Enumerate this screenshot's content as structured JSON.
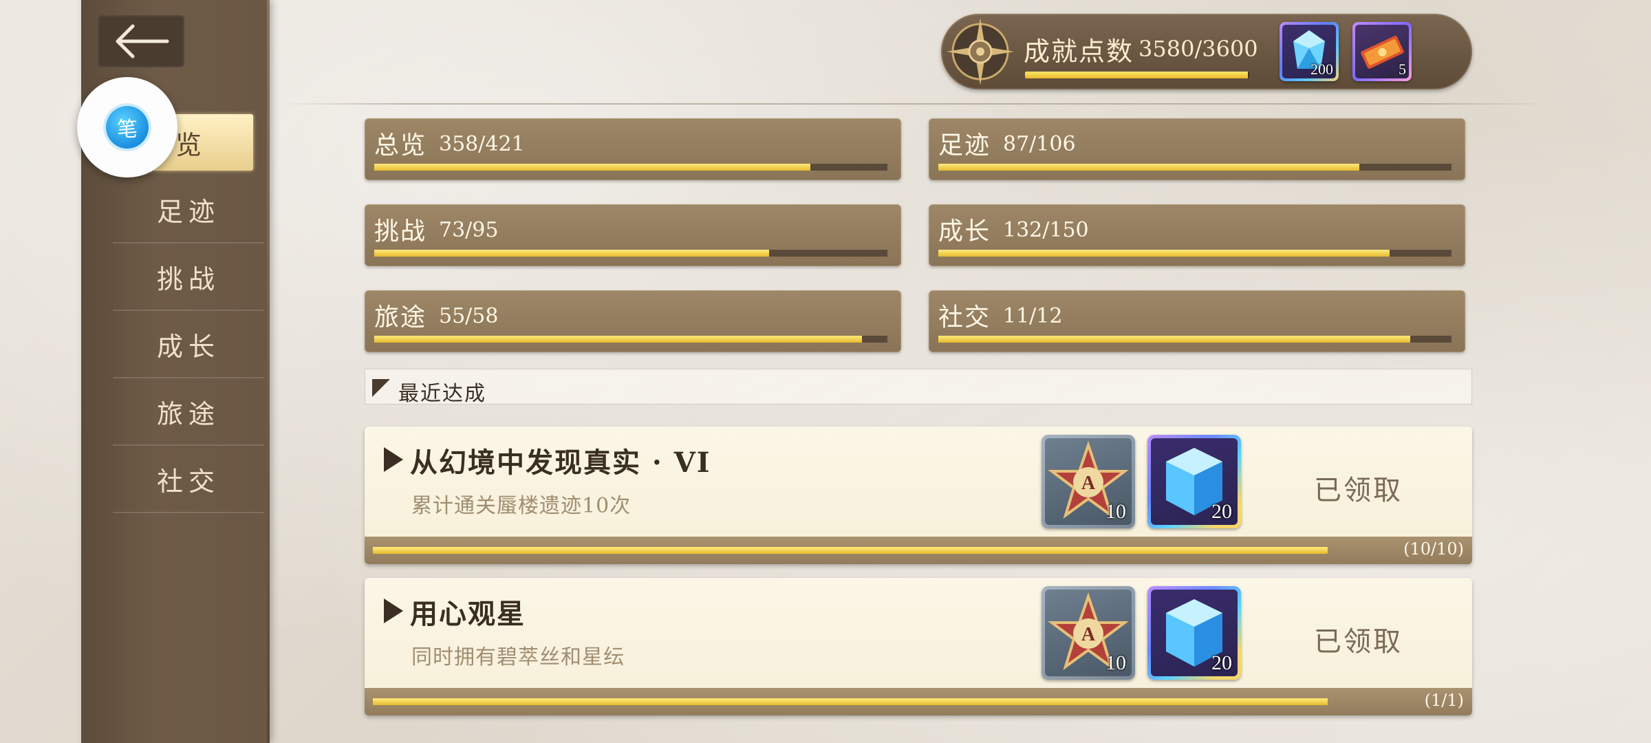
{
  "nav": {
    "items": [
      {
        "label": "总览"
      },
      {
        "label": "足迹"
      },
      {
        "label": "挑战"
      },
      {
        "label": "成长"
      },
      {
        "label": "旅途"
      },
      {
        "label": "社交"
      }
    ],
    "active_visible_text": "览",
    "float_button_glyph": "笔"
  },
  "header": {
    "points_label": "成就点数",
    "points_value": "3580/3600",
    "points_progress": 0.994,
    "items": [
      {
        "name": "crystal-icon",
        "count": "200"
      },
      {
        "name": "ticket-icon",
        "count": "5"
      }
    ]
  },
  "categories": [
    {
      "name": "总览",
      "value": "358/421",
      "progress": 0.85
    },
    {
      "name": "足迹",
      "value": "87/106",
      "progress": 0.82
    },
    {
      "name": "挑战",
      "value": "73/95",
      "progress": 0.77
    },
    {
      "name": "成长",
      "value": "132/150",
      "progress": 0.88
    },
    {
      "name": "旅途",
      "value": "55/58",
      "progress": 0.95
    },
    {
      "name": "社交",
      "value": "11/12",
      "progress": 0.92
    }
  ],
  "recent": {
    "title": "最近达成",
    "achievements": [
      {
        "title": "从幻境中发现真实 · VI",
        "description": "累计通关蜃楼遗迹10次",
        "status": "已领取",
        "progress_text": "(10/10)",
        "progress": 1.0,
        "rewards": [
          {
            "name": "star-a-icon",
            "count": "10"
          },
          {
            "name": "cube-icon",
            "count": "20"
          }
        ]
      },
      {
        "title": "用心观星",
        "description": "同时拥有碧萃丝和星纭",
        "status": "已领取",
        "progress_text": "(1/1)",
        "progress": 1.0,
        "rewards": [
          {
            "name": "star-a-icon",
            "count": "10"
          },
          {
            "name": "cube-icon",
            "count": "20"
          }
        ]
      }
    ]
  },
  "colors": {
    "accent_gold": "#e6bb2e",
    "sidebar_brown": "#6e5b47",
    "card_brown": "#9d8767"
  }
}
